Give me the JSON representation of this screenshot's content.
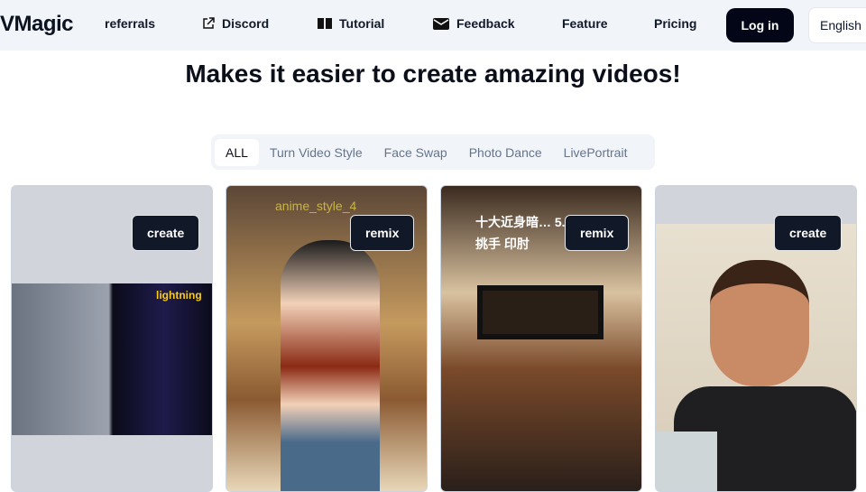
{
  "header": {
    "logo": "VMagic",
    "nav": [
      {
        "label": "referrals",
        "icon": ""
      },
      {
        "label": "Discord",
        "icon": "external-link-icon"
      },
      {
        "label": "Tutorial",
        "icon": "book-icon"
      },
      {
        "label": "Feedback",
        "icon": "mail-icon"
      },
      {
        "label": "Feature",
        "icon": ""
      },
      {
        "label": "Pricing",
        "icon": ""
      }
    ],
    "login": "Log in",
    "language": "English"
  },
  "main": {
    "title": "Makes it easier to create amazing videos!",
    "tabs": [
      {
        "label": "ALL",
        "active": true
      },
      {
        "label": "Turn Video Style"
      },
      {
        "label": "Face Swap"
      },
      {
        "label": "Photo Dance"
      },
      {
        "label": "LivePortrait"
      }
    ],
    "cards": [
      {
        "button": "create",
        "overlay": "lightning"
      },
      {
        "button": "remix",
        "overlay": "anime_style_4"
      },
      {
        "button": "remix",
        "overlay": "十大近身暗… 5.挑手 印肘"
      },
      {
        "button": "create",
        "overlay": ""
      }
    ]
  },
  "colors": {
    "header_bg": "#f1f5f9",
    "primary": "#020617"
  }
}
